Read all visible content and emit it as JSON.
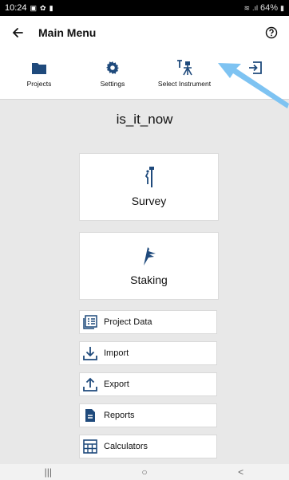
{
  "status": {
    "time": "10:24",
    "battery": "64%"
  },
  "appbar": {
    "title": "Main Menu"
  },
  "toolbar": {
    "items": [
      {
        "label": "Projects",
        "icon": "folder-icon"
      },
      {
        "label": "Settings",
        "icon": "gear-icon"
      },
      {
        "label": "Select Instrument",
        "icon": "instrument-icon"
      },
      {
        "label": "",
        "icon": "exit-icon"
      }
    ]
  },
  "main": {
    "project_name": "is_it_now",
    "cards": [
      {
        "label": "Survey",
        "icon": "survey-pole-icon"
      },
      {
        "label": "Staking",
        "icon": "staking-icon"
      }
    ],
    "buttons": [
      {
        "label": "Project Data",
        "icon": "data-list-icon"
      },
      {
        "label": "Import",
        "icon": "import-icon"
      },
      {
        "label": "Export",
        "icon": "export-icon"
      },
      {
        "label": "Reports",
        "icon": "document-icon"
      },
      {
        "label": "Calculators",
        "icon": "calculator-icon"
      }
    ]
  },
  "navbar": {
    "recent": "|||",
    "home": "○",
    "back": "<"
  },
  "colors": {
    "accent": "#1f4a7c",
    "arrow": "#7ec3f2",
    "background": "#e8e8e8"
  }
}
